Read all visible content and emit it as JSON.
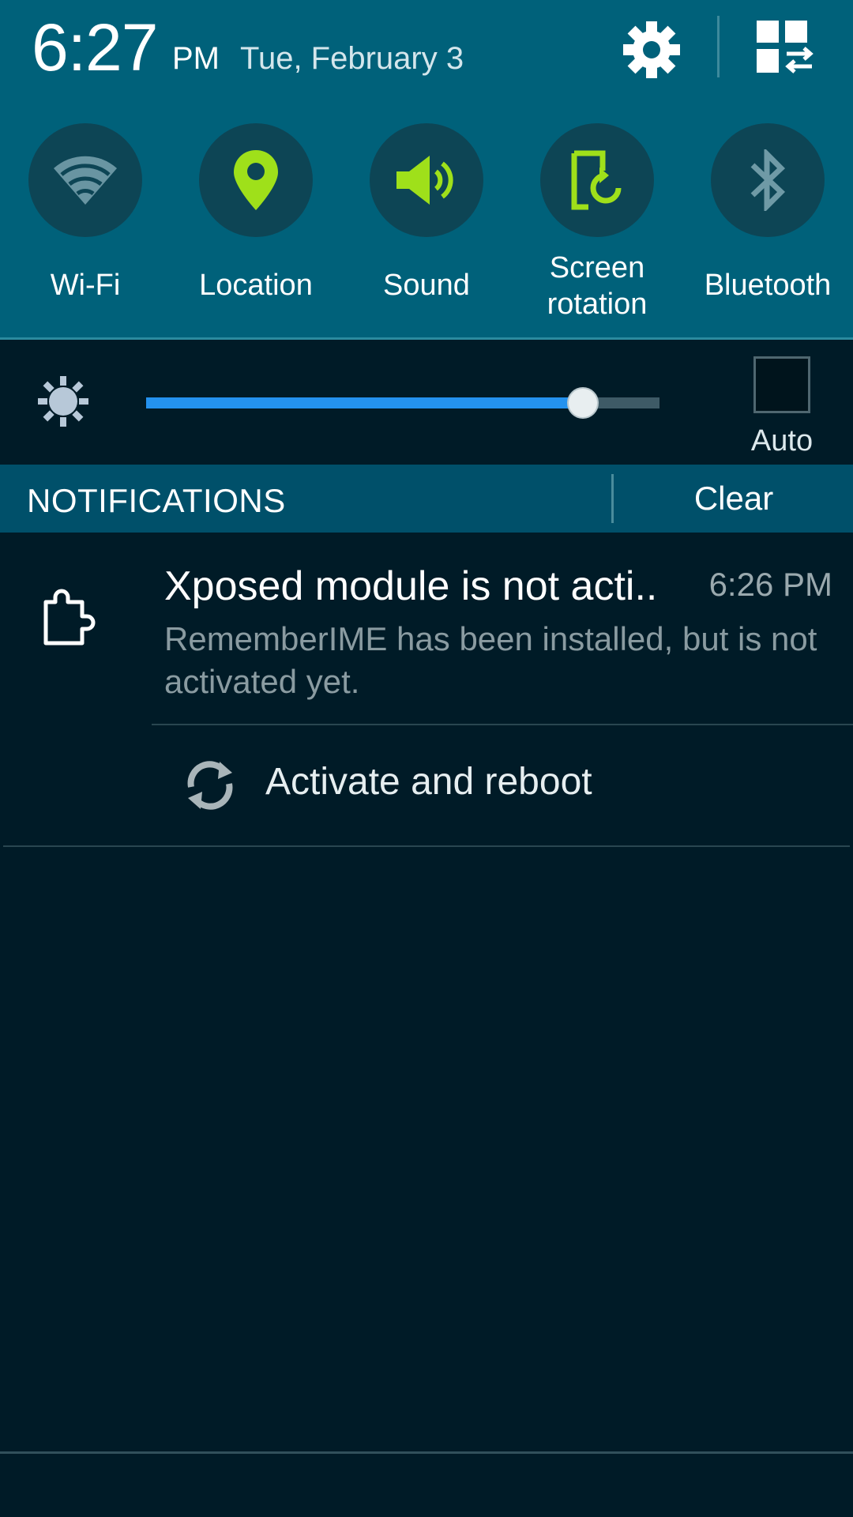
{
  "header": {
    "time": "6:27",
    "ampm": "PM",
    "date": "Tue, February 3",
    "settings_icon": "gear-icon",
    "edit_icon": "grid-swap-icon"
  },
  "quick_toggles": [
    {
      "label": "Wi-Fi",
      "icon": "wifi-icon",
      "active": false
    },
    {
      "label": "Location",
      "icon": "location-pin-icon",
      "active": true
    },
    {
      "label": "Sound",
      "icon": "speaker-icon",
      "active": true
    },
    {
      "label": "Screen rotation",
      "line1": "Screen",
      "line2": "rotation",
      "icon": "screen-rotation-icon",
      "active": true
    },
    {
      "label": "Bluetooth",
      "icon": "bluetooth-icon",
      "active": false
    }
  ],
  "brightness": {
    "icon": "brightness-sun-icon",
    "level": 0.85,
    "auto_label": "Auto",
    "auto_checked": false
  },
  "notifications_bar": {
    "title": "NOTIFICATIONS",
    "clear_label": "Clear"
  },
  "notifications": [
    {
      "icon": "puzzle-piece-icon",
      "title": "Xposed module is not acti..",
      "time": "6:26 PM",
      "body": "RememberIME has been installed, but is not activated yet.",
      "action": {
        "icon": "sync-icon",
        "label": "Activate and reboot"
      }
    }
  ],
  "colors": {
    "header_bg": "#00617a",
    "active_toggle": "#9fe01a",
    "inactive_toggle": "#6f9aa6",
    "slider_fill": "#2492ee",
    "panel_bg": "#001b27"
  }
}
